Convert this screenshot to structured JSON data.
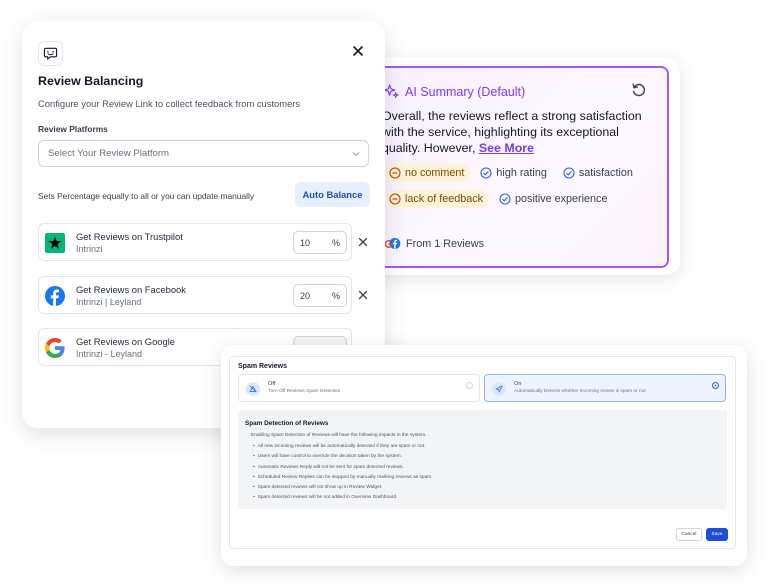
{
  "ai_summary": {
    "title": "AI Summary (Default)",
    "text": "Overall, the reviews reflect a strong satisfaction with the service, highlighting its exceptional quality. However,",
    "see_more": "See More",
    "tags": [
      {
        "label": "no comment",
        "sentiment": "negative"
      },
      {
        "label": "high rating",
        "sentiment": "positive"
      },
      {
        "label": "satisfaction",
        "sentiment": "positive"
      },
      {
        "label": "lack of feedback",
        "sentiment": "negative"
      },
      {
        "label": "positive experience",
        "sentiment": "positive"
      }
    ],
    "footer": "From 1 Reviews",
    "accent_color": "#a855f7"
  },
  "review_balancing": {
    "title": "Review Balancing",
    "subtitle": "Configure your Review Link to collect feedback from customers",
    "platforms_label": "Review Platforms",
    "select_placeholder": "Select Your Review Platform",
    "auto_text": "Sets Percentage equally to all or you can update manually",
    "auto_button": "Auto Balance",
    "platforms": [
      {
        "name": "Get Reviews on Trustpilot",
        "location": "Intrinzi",
        "percent": "10",
        "unit": "%",
        "icon": "trustpilot-icon"
      },
      {
        "name": "Get Reviews on Facebook",
        "location": "Intrinzi | Leyland",
        "percent": "20",
        "unit": "%",
        "icon": "facebook-icon"
      },
      {
        "name": "Get Reviews on Google",
        "location": "Intrinzi - Leyland",
        "percent": "",
        "unit": "",
        "icon": "google-icon"
      }
    ]
  },
  "spam": {
    "title": "Spam Reviews",
    "options": [
      {
        "title": "Off",
        "desc": "Turn Off Reviews Spam Detection",
        "selected": false
      },
      {
        "title": "On",
        "desc": "Automatically Detects whether incoming review is spam or not",
        "selected": true
      }
    ],
    "info_title": "Spam Detection of Reviews",
    "info_lead": "Enabling Spam Detection of Reviews will have the following impacts in the system.",
    "info_items": [
      "All new incoming reviews will be automatically detected if they are spam or not.",
      "Users will have control to override the decision taken by the system.",
      "Automatic Reviews Reply will not be sent for spam detected reviews.",
      "Scheduled Review Replies can be stopped by manually marking reviews as spam.",
      "Spam detected reviews will not show up in Review Widget.",
      "Spam detected reviews will be not added in Overview Dashboard."
    ],
    "cancel": "Cancel",
    "save": "Save"
  }
}
